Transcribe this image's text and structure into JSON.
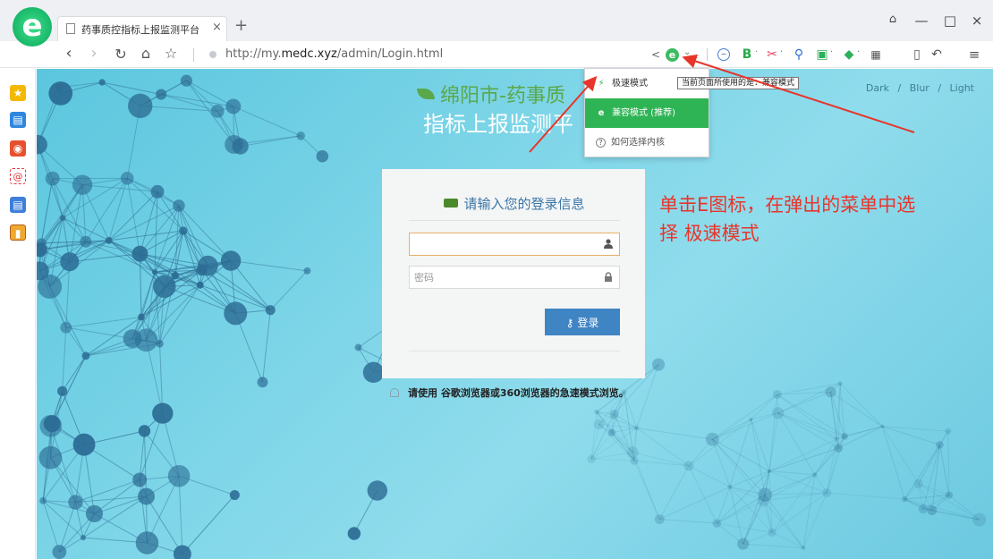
{
  "browser": {
    "tab_title": "药事质控指标上报监测平台",
    "tab_close": "×",
    "new_tab": "+",
    "url_plain_prefix": "http://my.",
    "url_domain": "medc.xyz",
    "url_path": "/admin/Login.html",
    "icons": [
      "back-icon",
      "forward-icon",
      "refresh-icon",
      "home-icon",
      "favorite-star-icon",
      "share-icon",
      "engine-e-icon",
      "zoom-out-icon",
      "translate-icon",
      "screenshot-icon",
      "search-icon",
      "game-icon",
      "security-icon",
      "apps-icon",
      "reader-icon",
      "undo-icon",
      "menu-icon"
    ],
    "win_controls": {
      "skin": "👕",
      "minimize": "—",
      "maximize": "□",
      "close": "×"
    }
  },
  "sidebar": {
    "items": [
      {
        "name": "favorites-icon",
        "color": "#f5b800"
      },
      {
        "name": "news-icon",
        "color": "#2e86de"
      },
      {
        "name": "weibo-icon",
        "color": "#e8502d"
      },
      {
        "name": "mail-icon",
        "color": "#e0353b"
      },
      {
        "name": "docs-icon",
        "color": "#3d7fd9"
      },
      {
        "name": "notes-icon",
        "color": "#f0a830"
      }
    ]
  },
  "page": {
    "theme_links": [
      "Dark",
      "/",
      "Blur",
      "/",
      "Light"
    ],
    "title": "绵阳市-药事质",
    "subtitle": "指标上报监测平",
    "login": {
      "heading": "请输入您的登录信息",
      "username_value": "",
      "password_placeholder": "密码",
      "submit_label": "登录"
    },
    "notice": "请使用 谷歌浏览器或360浏览器的急速模式浏览。",
    "annotation_line1": "单击E图标，在弹出的菜单中选",
    "annotation_line2": "择  极速模式"
  },
  "dropdown": {
    "items": [
      {
        "label": "极速模式",
        "icon": "⚡",
        "selected": false
      },
      {
        "label": "兼容模式 (推荐)",
        "icon": "e",
        "selected": true
      },
      {
        "label": "如何选择内核",
        "icon": "?",
        "selected": false
      }
    ],
    "tooltip": "当前页面所使用的是：兼容模式"
  },
  "colors": {
    "accent_green": "#2fb455",
    "login_button": "#3f84c3",
    "annotation_red": "#e8352b",
    "page_bg": "#7fd6e8"
  }
}
